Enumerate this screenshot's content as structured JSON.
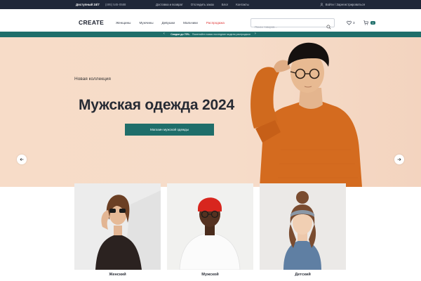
{
  "topbar": {
    "availability": "Доступный 24/7",
    "phone": "(495) 545-0588",
    "links": [
      "Доставка и возврат",
      "Отследить заказ",
      "Блог",
      "Контакты"
    ],
    "login": "Войти / Зарегистрироваться"
  },
  "header": {
    "logo": "CREATE",
    "nav": [
      "Женщины",
      "Мужчины",
      "Девушки",
      "Мальчики",
      "Распродажа"
    ],
    "search_placeholder": "Поиск товаров...",
    "wishlist_count": "3",
    "cart_count": "0"
  },
  "promo": {
    "headline": "Скидки до 70%.",
    "subtext": "Поменяйте новая последние модели распродажи"
  },
  "hero": {
    "kicker": "Новая коллекция",
    "title": "Мужская одежда 2024",
    "cta": "Магазин мужской одежды"
  },
  "categories": [
    {
      "label": "Женский"
    },
    {
      "label": "Мужской"
    },
    {
      "label": "Детский"
    }
  ],
  "icons": {
    "login": "user-icon",
    "search": "search-icon",
    "wishlist": "heart-icon",
    "cart": "cart-icon",
    "prev": "arrow-left-icon",
    "next": "arrow-right-icon"
  },
  "colors": {
    "topbar": "#1f2738",
    "accent": "#1f6e6a",
    "sale": "#e03a3a",
    "hero_bg": "#f7dcc8"
  }
}
